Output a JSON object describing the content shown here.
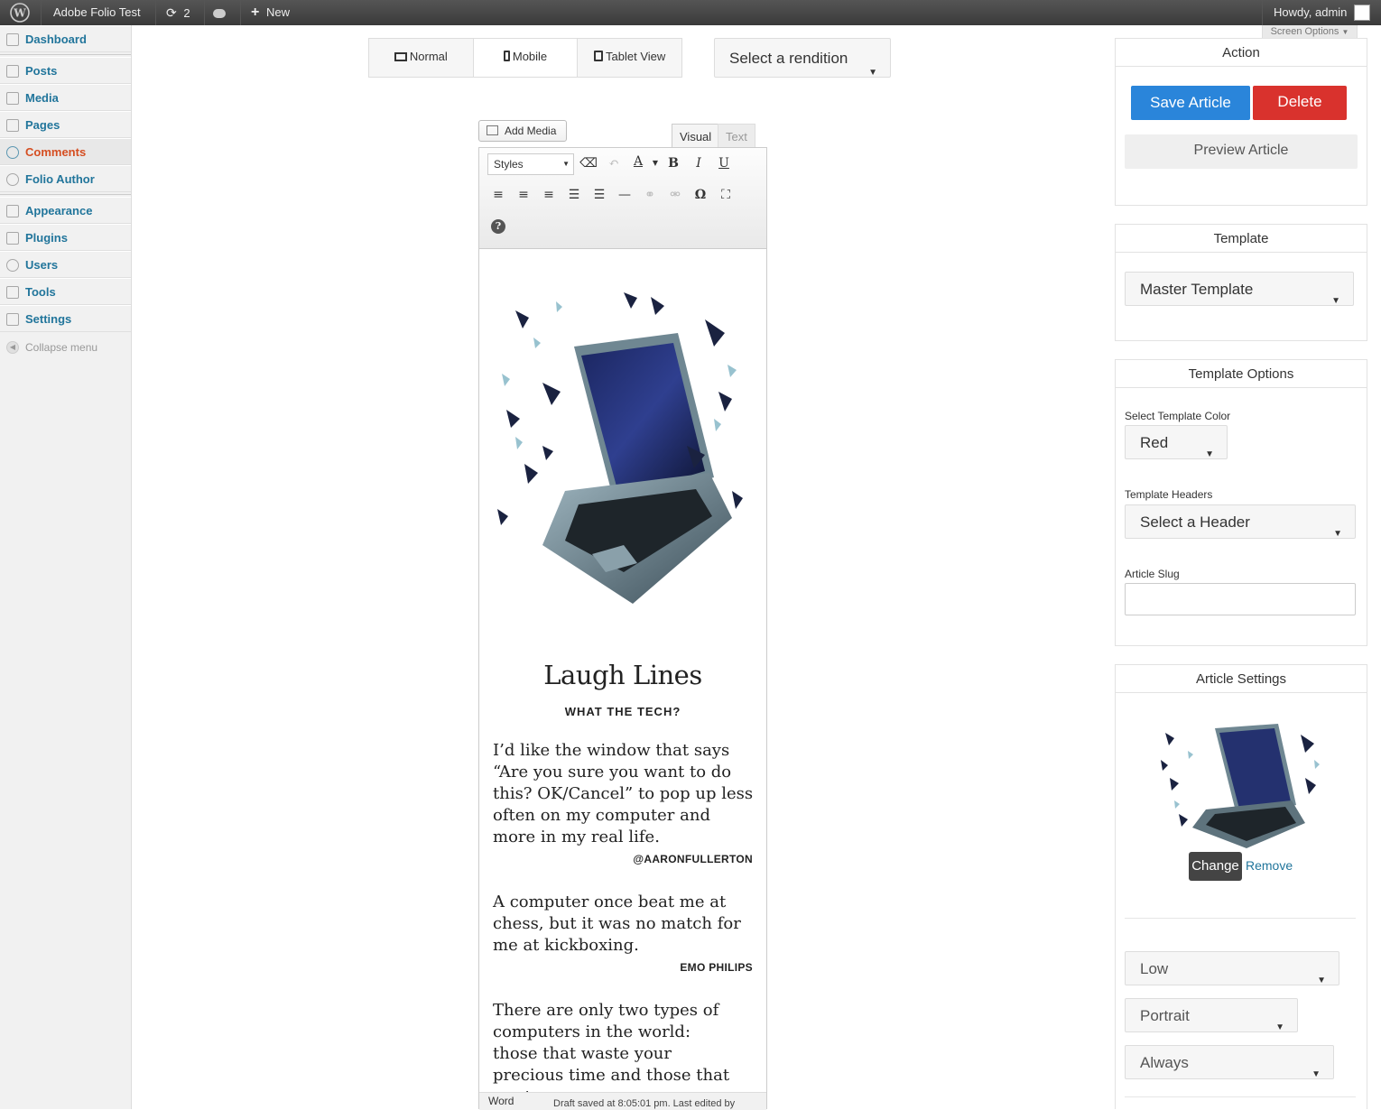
{
  "adminbar": {
    "site_name": "Adobe Folio Test",
    "updates_count": "2",
    "new_label": "New",
    "greeting": "Howdy, admin",
    "screen_options": "Screen Options"
  },
  "sidebar": {
    "items": [
      {
        "label": "Dashboard",
        "icon": "dashboard-icon"
      },
      {
        "label": "Posts",
        "icon": "pin-icon"
      },
      {
        "label": "Media",
        "icon": "media-icon"
      },
      {
        "label": "Pages",
        "icon": "pages-icon"
      },
      {
        "label": "Comments",
        "icon": "comment-icon"
      },
      {
        "label": "Folio Author",
        "icon": "gear-icon"
      },
      {
        "label": "Appearance",
        "icon": "appearance-icon"
      },
      {
        "label": "Plugins",
        "icon": "plugin-icon"
      },
      {
        "label": "Users",
        "icon": "users-icon"
      },
      {
        "label": "Tools",
        "icon": "tools-icon"
      },
      {
        "label": "Settings",
        "icon": "settings-icon"
      }
    ],
    "collapse_label": "Collapse menu",
    "active_color": "#d54e21"
  },
  "view_toggle": {
    "normal": "Normal",
    "mobile": "Mobile",
    "tablet": "Tablet View"
  },
  "rendition_select": "Select a rendition",
  "editor": {
    "add_media": "Add Media",
    "tab_visual": "Visual",
    "tab_text": "Text",
    "styles_select": "Styles",
    "title": "Laugh Lines",
    "subtitle": "WHAT THE TECH?",
    "quotes": [
      {
        "text": "I’d like the window that says “Are you sure you want to do this? OK/Cancel” to pop up less often on my computer and more in my real life.",
        "author": "@AARONFULLERTON"
      },
      {
        "text": "A computer once beat me at chess, but it was no match for me at kickboxing.",
        "author": "EMO PHILIPS"
      },
      {
        "text": "There are only two types of computers in the world: those that waste your precious time and those that waste your",
        "author": ""
      }
    ],
    "status_word": "Word",
    "status_draft": "Draft saved at 8:05:01 pm. Last edited by"
  },
  "action_panel": {
    "title": "Action",
    "save": "Save Article",
    "delete": "Delete",
    "preview": "Preview Article",
    "save_color": "#2a85da",
    "delete_color": "#d9322d"
  },
  "template_panel": {
    "title": "Template",
    "selected": "Master Template"
  },
  "template_options": {
    "title": "Template Options",
    "color_label": "Select Template Color",
    "color_value": "Red",
    "headers_label": "Template Headers",
    "headers_value": "Select a Header",
    "slug_label": "Article Slug",
    "slug_value": ""
  },
  "article_settings": {
    "title": "Article Settings",
    "change": "Change",
    "remove": "Remove",
    "selects": [
      "Low",
      "Portrait",
      "Always"
    ]
  }
}
